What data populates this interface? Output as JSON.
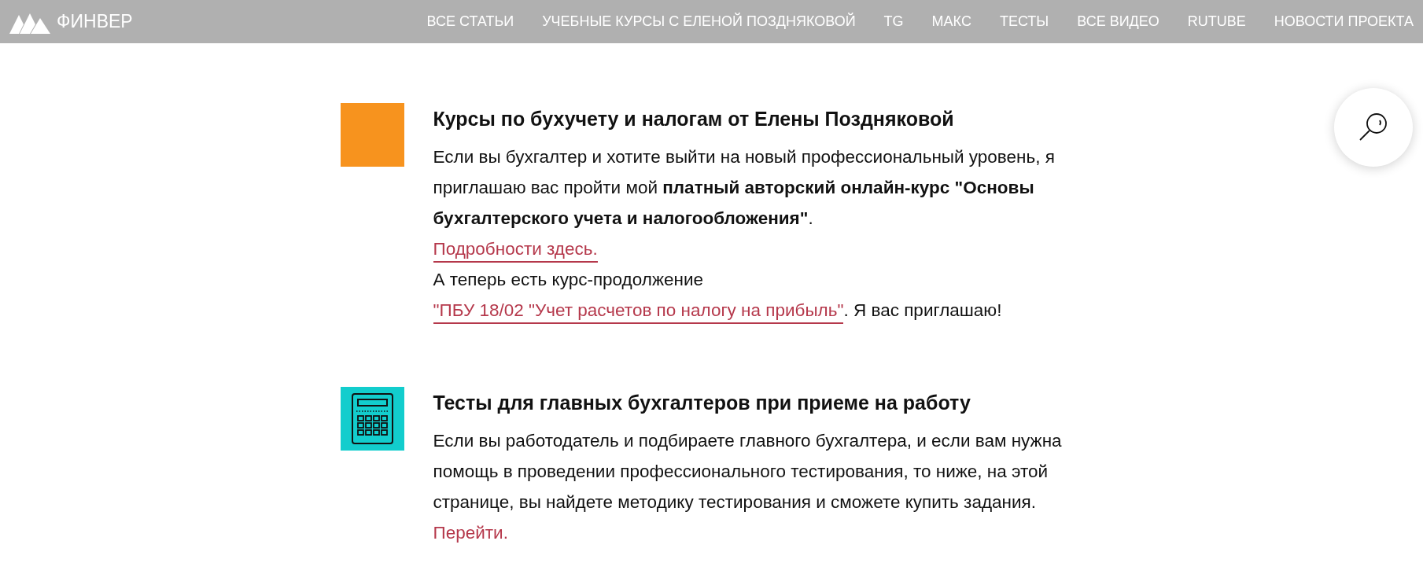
{
  "header": {
    "logo_text": "ФИНВЕР",
    "nav": [
      "ВСЕ СТАТЬИ",
      "УЧЕБНЫЕ КУРСЫ С ЕЛЕНОЙ ПОЗДНЯКОВОЙ",
      "TG",
      "МАКС",
      "ТЕСТЫ",
      "ВСЕ ВИДЕО",
      "RUTUBE",
      "НОВОСТИ ПРОЕКТА"
    ]
  },
  "sections": [
    {
      "kind": "photo",
      "title": "Курсы по бухучету и налогам от Елены Поздняковой",
      "paragraphs": [
        [
          {
            "kind": "text",
            "text": "Если вы бухгалтер и хотите выйти на новый профессиональный уровень, я приглашаю вас пройти мой **платный авторский онлайн-курс \"Основы бухгалтерского учета и налогообложения\"**."
          }
        ],
        [
          {
            "kind": "link",
            "text": "Подробности здесь.",
            "underlined": true
          }
        ],
        [
          {
            "kind": "text",
            "text": "А теперь есть курс-продолжение "
          },
          {
            "kind": "link",
            "text": "\"ПБУ 18/02 \"Учет расчетов по налогу на прибыль\"",
            "underlined": true
          },
          {
            "kind": "text",
            "text": ". Я вас приглашаю!"
          }
        ]
      ]
    },
    {
      "kind": "calculator",
      "title": "Тесты для главных бухгалтеров при приеме на работу",
      "paragraphs": [
        [
          {
            "kind": "text",
            "text": "Если вы работодатель и подбираете главного бухгалтера, и если вам нужна помощь в проведении профессионального тестирования, то ниже, на этой странице, вы найдете методику тестирования и сможете купить задания. "
          },
          {
            "kind": "link",
            "text": "Перейти.",
            "underlined": false
          }
        ]
      ]
    }
  ]
}
